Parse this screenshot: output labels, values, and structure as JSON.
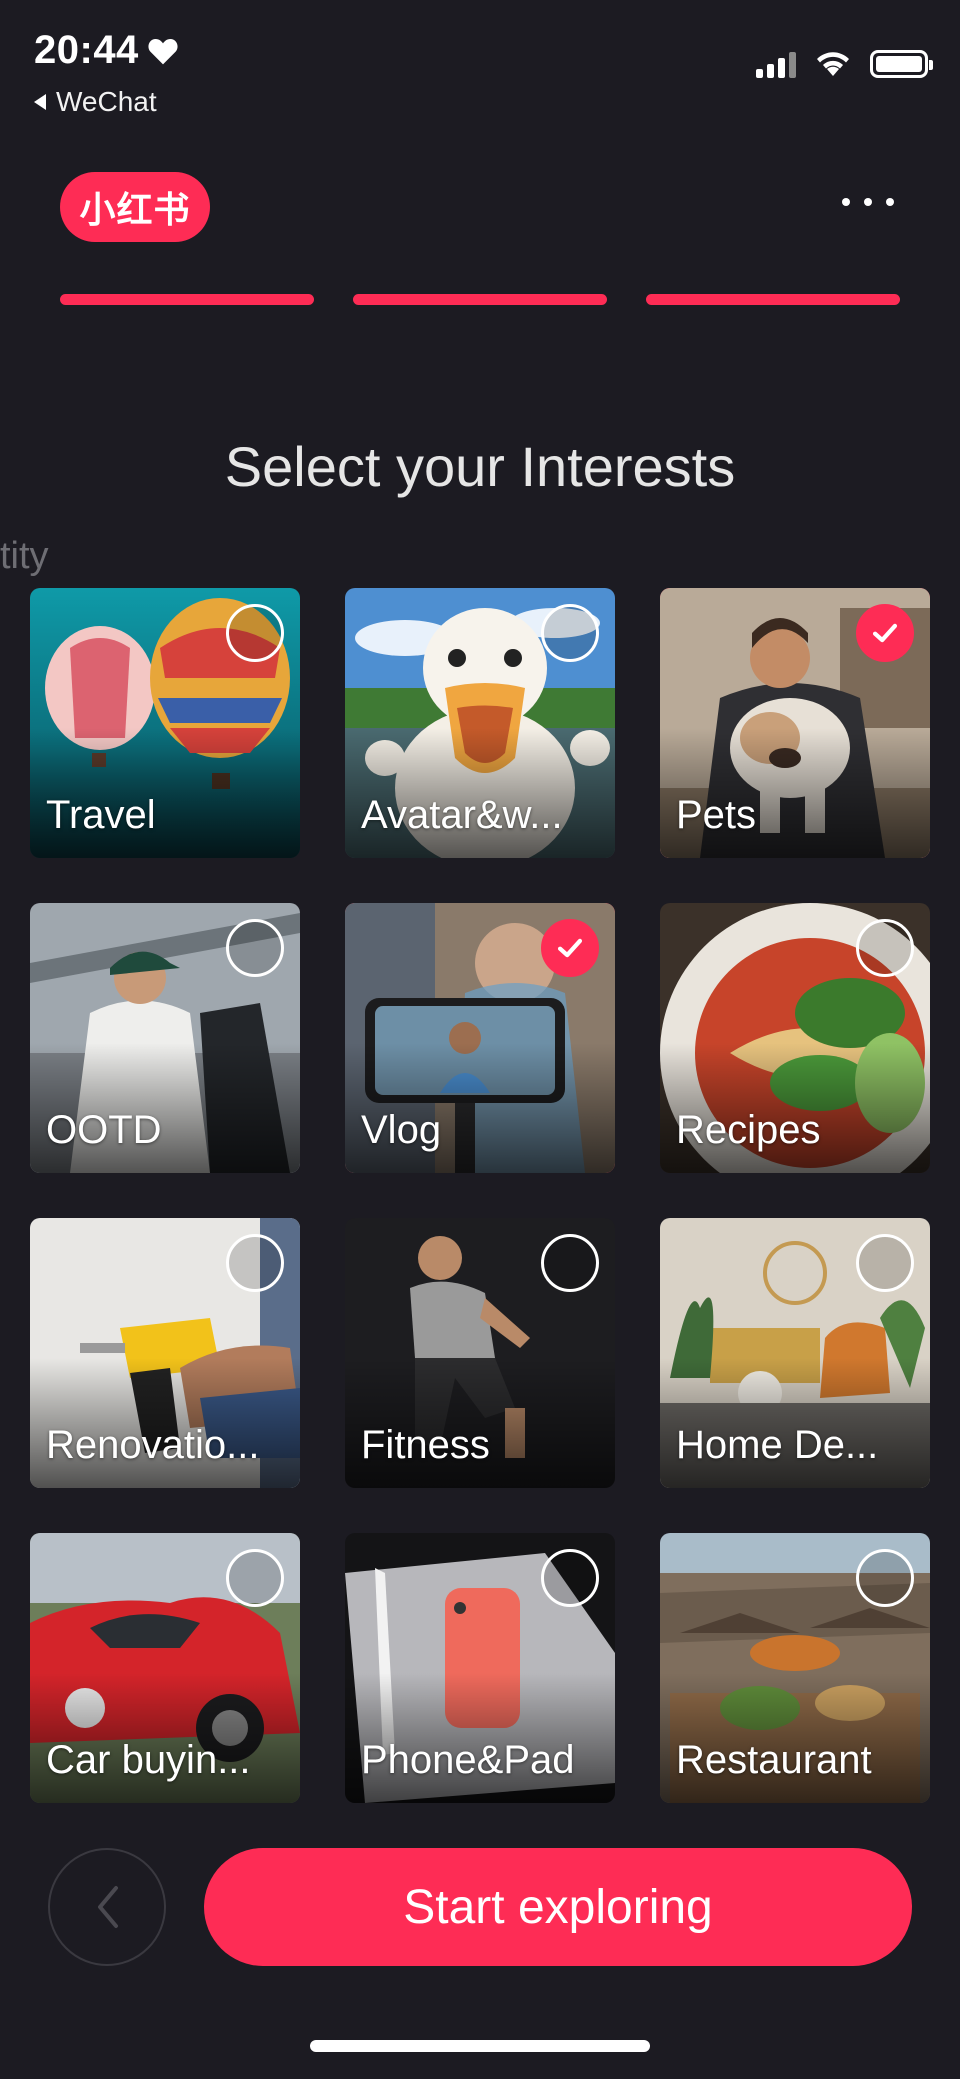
{
  "status": {
    "time": "20:44",
    "back_app": "WeChat"
  },
  "header": {
    "logo_text": "小红书",
    "progress_steps": 3
  },
  "title": "Select your Interests",
  "ghost_text": "tity",
  "interests": [
    {
      "label": "Travel",
      "selected": false
    },
    {
      "label": "Avatar&w...",
      "selected": false
    },
    {
      "label": "Pets",
      "selected": true
    },
    {
      "label": "OOTD",
      "selected": false
    },
    {
      "label": "Vlog",
      "selected": true
    },
    {
      "label": "Recipes",
      "selected": false
    },
    {
      "label": "Renovatio...",
      "selected": false
    },
    {
      "label": "Fitness",
      "selected": false
    },
    {
      "label": "Home De...",
      "selected": false
    },
    {
      "label": "Car buyin...",
      "selected": false
    },
    {
      "label": "Phone&Pad",
      "selected": false
    },
    {
      "label": "Restaurant",
      "selected": false
    }
  ],
  "footer": {
    "start_label": "Start exploring"
  },
  "colors": {
    "accent": "#fe2c55",
    "background": "#1c1b22"
  },
  "icons": {
    "heart": "heart-icon",
    "back": "chevron-left-icon",
    "check": "checkmark-icon",
    "more": "more-dots-icon"
  }
}
